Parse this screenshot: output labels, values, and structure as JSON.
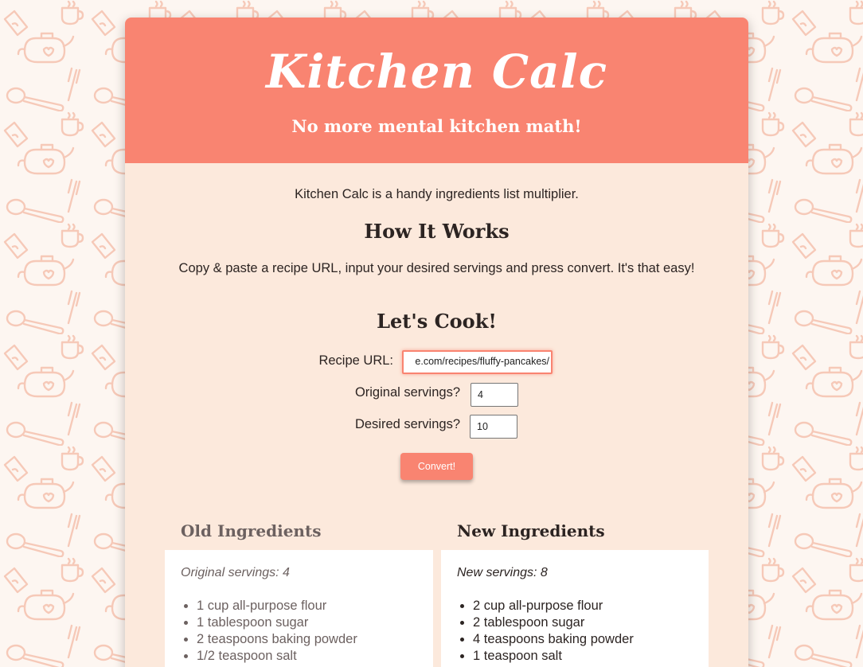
{
  "header": {
    "logo": "Kitchen Calc",
    "tagline": "No more mental kitchen math!"
  },
  "intro": {
    "text": "Kitchen Calc is a handy ingredients list multiplier."
  },
  "how_it_works": {
    "title": "How It Works",
    "text": "Copy & paste a recipe URL, input your desired servings and press convert. It's that easy!"
  },
  "form": {
    "title": "Let's Cook!",
    "url_label": "Recipe URL:",
    "url_value": "e.com/recipes/fluffy-pancakes/",
    "original_label": "Original servings?",
    "original_value": "4",
    "desired_label": "Desired servings?",
    "desired_value": "10",
    "convert_label": "Convert!"
  },
  "old_ingredients": {
    "title": "Old Ingredients",
    "servings": "Original servings: 4",
    "items": [
      "1 cup all-purpose flour",
      "1 tablespoon sugar",
      "2 teaspoons baking powder",
      "1/2 teaspoon salt"
    ]
  },
  "new_ingredients": {
    "title": "New Ingredients",
    "servings": "New servings: 8",
    "items": [
      "2 cup all-purpose flour",
      "2 tablespoon sugar",
      "4 teaspoons baking powder",
      "1 teaspoon salt"
    ]
  },
  "colors": {
    "accent": "#f98471",
    "card_bg": "#fce9dc",
    "pattern": "#f6c9b8"
  }
}
